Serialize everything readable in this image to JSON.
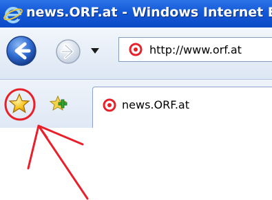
{
  "window": {
    "title": "news.ORF.at - Windows Internet Explorer",
    "logo_icon": "internet-explorer-logo-icon"
  },
  "navigation": {
    "back_icon": "back-arrow-icon",
    "forward_icon": "forward-arrow-icon",
    "history_icon": "dropdown-arrow-icon",
    "address": {
      "url": "http://www.orf.at",
      "site_icon": "orf-target-icon"
    }
  },
  "favorites_bar": {
    "favorites_icon": "favorites-star-icon",
    "add_favorite_icon": "add-to-favorites-icon",
    "tab": {
      "label": "news.ORF.at",
      "site_icon": "orf-target-icon"
    }
  },
  "annotation": {
    "color": "#e8202a"
  },
  "colors": {
    "titlebar": "#1458d6",
    "accent": "#e8202a"
  }
}
